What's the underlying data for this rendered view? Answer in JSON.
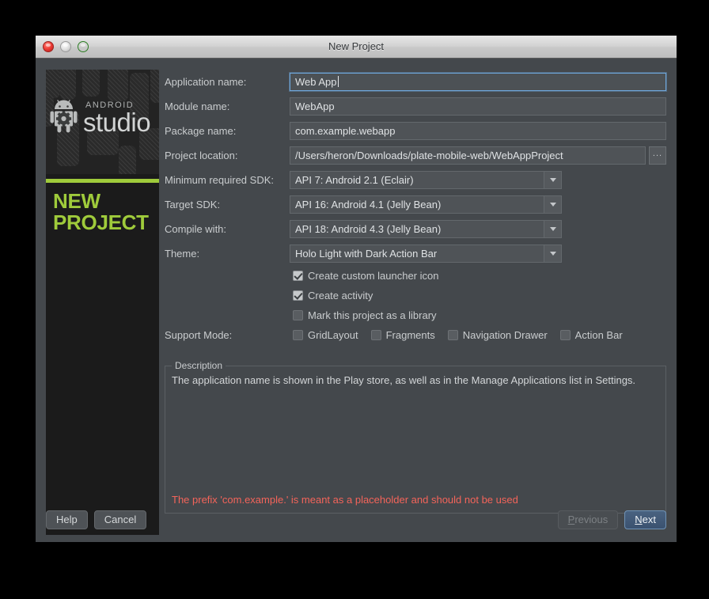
{
  "window": {
    "title": "New Project"
  },
  "traffic_lights": {
    "close": "close-button",
    "minimize": "minimize-button",
    "zoom": "zoom-button"
  },
  "banner": {
    "brand_small": "ANDROID",
    "brand_large": "studio",
    "heading_line1": "NEW",
    "heading_line2": "PROJECT",
    "accent_color": "#9fcb3b",
    "background_color": "#1b1b1b"
  },
  "form": {
    "fields": [
      {
        "label": "Application name:",
        "value": "Web App",
        "type": "text",
        "focused": true
      },
      {
        "label": "Module name:",
        "value": "WebApp",
        "type": "text",
        "focused": false
      },
      {
        "label": "Package name:",
        "value": "com.example.webapp",
        "type": "text",
        "focused": false
      },
      {
        "label": "Project location:",
        "value": "/Users/heron/Downloads/plate-mobile-web/WebAppProject",
        "type": "path",
        "focused": false
      }
    ],
    "browse_button_label": "...",
    "selects": [
      {
        "label": "Minimum required SDK:",
        "value": "API 7: Android 2.1 (Eclair)"
      },
      {
        "label": "Target SDK:",
        "value": "API 16: Android 4.1 (Jelly Bean)"
      },
      {
        "label": "Compile with:",
        "value": "API 18: Android 4.3 (Jelly Bean)"
      },
      {
        "label": "Theme:",
        "value": "Holo Light with Dark Action Bar"
      }
    ],
    "checkboxes": [
      {
        "label": "Create custom launcher icon",
        "checked": true
      },
      {
        "label": "Create activity",
        "checked": true
      },
      {
        "label": "Mark this project as a library",
        "checked": false
      }
    ],
    "support_mode": {
      "label": "Support Mode:",
      "options": [
        {
          "label": "GridLayout",
          "checked": false
        },
        {
          "label": "Fragments",
          "checked": false
        },
        {
          "label": "Navigation Drawer",
          "checked": false
        },
        {
          "label": "Action Bar",
          "checked": false
        }
      ]
    }
  },
  "description": {
    "legend": "Description",
    "body": "The application name is shown in the Play store, as well as in the Manage Applications list in Settings.",
    "warning": "The prefix 'com.example.' is meant as a placeholder and should not be used",
    "warning_color": "#f4645a"
  },
  "footer": {
    "help_label": "Help",
    "cancel_label": "Cancel",
    "previous_label": "Previous",
    "previous_mnemonic": "P",
    "next_label": "Next",
    "next_mnemonic": "N",
    "previous_disabled": true
  }
}
